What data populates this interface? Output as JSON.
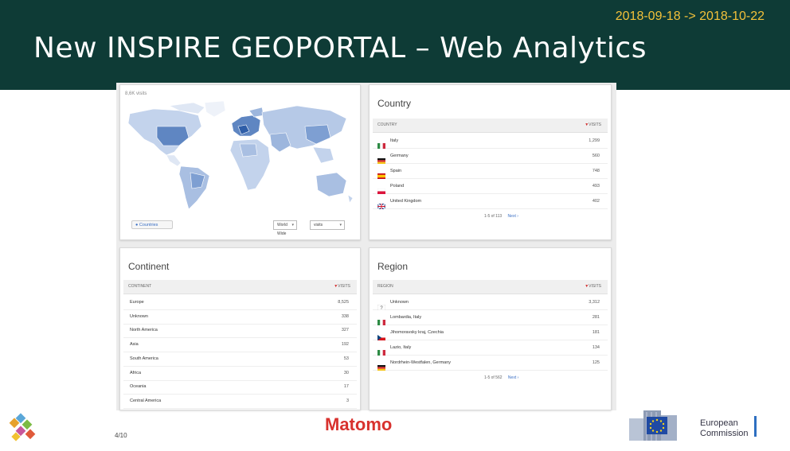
{
  "header": {
    "date_range": "2018-09-18 -> 2018-10-22",
    "title": "New INSPIRE GEOPORTAL – Web Analytics"
  },
  "map_panel": {
    "label": "8,6K visits",
    "zoom_label": "Countries",
    "view_select": "World Wide",
    "metric_select": "visits"
  },
  "country_panel": {
    "title": "Country",
    "col_label": "COUNTRY",
    "col_visits": "VISITS",
    "rows": [
      {
        "name": "Italy",
        "visits": "1,299",
        "flag": "it"
      },
      {
        "name": "Germany",
        "visits": "560",
        "flag": "de"
      },
      {
        "name": "Spain",
        "visits": "748",
        "flag": "es"
      },
      {
        "name": "Poland",
        "visits": "493",
        "flag": "pl"
      },
      {
        "name": "United Kingdom",
        "visits": "402",
        "flag": "uk"
      }
    ],
    "pager": "1-5 of 113",
    "next": "Next ›"
  },
  "continent_panel": {
    "title": "Continent",
    "col_label": "CONTINENT",
    "col_visits": "VISITS",
    "rows": [
      {
        "name": "Europe",
        "visits": "8,525"
      },
      {
        "name": "Unknown",
        "visits": "338"
      },
      {
        "name": "North America",
        "visits": "327"
      },
      {
        "name": "Asia",
        "visits": "192"
      },
      {
        "name": "South America",
        "visits": "53"
      },
      {
        "name": "Africa",
        "visits": "30"
      },
      {
        "name": "Oceania",
        "visits": "17"
      },
      {
        "name": "Central America",
        "visits": "3"
      }
    ]
  },
  "region_panel": {
    "title": "Region",
    "col_label": "REGION",
    "col_visits": "VISITS",
    "rows": [
      {
        "name": "Unknown",
        "visits": "3,312",
        "flag": "unknown"
      },
      {
        "name": "Lombardia, Italy",
        "visits": "281",
        "flag": "it"
      },
      {
        "name": "Jihomoravsky kraj, Czechia",
        "visits": "181",
        "flag": "cz"
      },
      {
        "name": "Lazio, Italy",
        "visits": "134",
        "flag": "it"
      },
      {
        "name": "Nordrhein-Westfalen, Germany",
        "visits": "125",
        "flag": "de"
      }
    ],
    "pager": "1-5 of 562",
    "next": "Next ›"
  },
  "footer": {
    "page_number": "4/10",
    "brand": "Matomo",
    "ec_line1": "European",
    "ec_line2": "Commission"
  },
  "colors": {
    "header_bg": "#0e3b36",
    "date_color": "#f3c13a",
    "matomo_red": "#d8322e",
    "map_fill": "#9db6dd"
  }
}
